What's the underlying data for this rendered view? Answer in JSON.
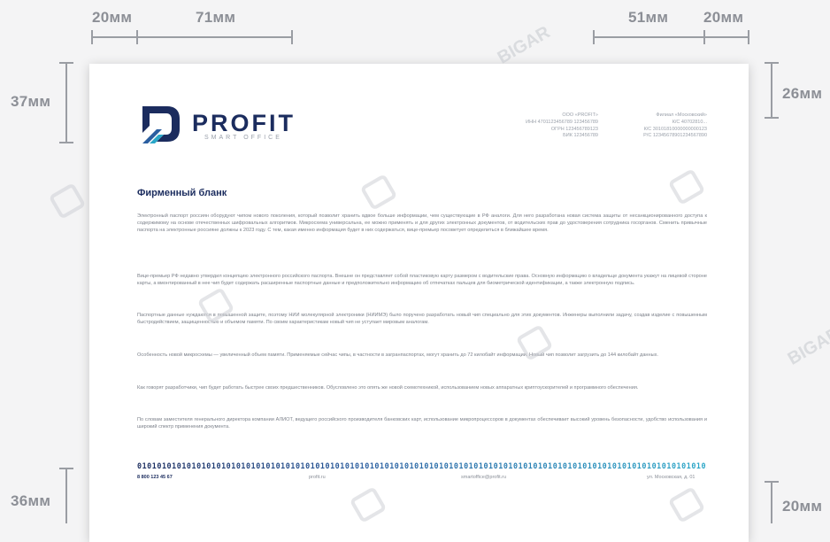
{
  "dimensions": {
    "top_left": "20мм",
    "top_logo": "71мм",
    "top_req": "51мм",
    "top_right": "20мм",
    "left_top": "37мм",
    "right_top": "26мм",
    "left_bottom": "36мм",
    "right_bottom": "20мм"
  },
  "watermark": "BIGAR",
  "letterhead": {
    "brand": "PROFIT",
    "brand_sub": "SMART OFFICE",
    "requisites_left": [
      "ООО «PROFIT»",
      "ИНН 4701123456789 123456789",
      "ОГРН 123456789123",
      "БИК 123456789"
    ],
    "requisites_right": [
      "Филиал «Московский»",
      "К/С 40702810...",
      "К/С 30101810000000000123",
      "Р/С 12345678901234567890"
    ],
    "title": "Фирменный бланк",
    "paragraphs": [
      "Электронный паспорт россиян оборудуют чипом нового поколения, который позволит хранить вдвое больше информации, чем существующие в РФ аналоги. Для него разработана новая система защиты от несанкционированного доступа к содержимому на основе отечественных шифровальных алгоритмов. Микросхема универсальна, ее можно применять и для других электронных документов, от водительских прав до удостоверения сотрудника госорганов. Сменить привычные паспорта на электронные россияне должны к 2023 году. С тем, какая именно информация будет в них содержаться, вице-премьер посоветует определиться в ближайшее время.",
      "Вице-премьер РФ недавно утвердил концепцию электронного российского паспорта. Внешне он представляет собой пластиковую карту размером с водительские права. Основную информацию о владельце документа укажут на лицевой стороне карты, а вмонтированный в нее чип будет содержать расширенные паспортные данные и предположительно информацию об отпечатках пальцев для биометрической идентификации, а также электронную подпись.",
      "Паспортные данные нуждаются в повышенной защите, поэтому НИИ молекулярной электроники (НИИМЭ) было поручено разработать новый чип специально для этих документов. Инженеры выполнили задачу, создав изделие с повышенным быстродействием, защищенностью и объемом памяти. По своим характеристикам новый чип не уступает мировым аналогам.",
      "Особенность новой микросхемы — увеличенный объем памяти. Применяемые сейчас чипы, в частности в загранпаспортах, могут хранить до 72 килобайт информации. Новый чип позволит загрузить до 144 килобайт данных.",
      "Как говорят разработчики, чип будет работать быстрее своих предшественников. Обусловлено это опять же новой схемотехникой, использованием новых аппаратных криптоускорителей и программного обеспечения.",
      "По словам заместителя генерального директора компании АЛИОТ, ведущего российского производителя банковских карт, использование микропроцессоров в документах обеспечивает высокий уровень безопасности, удобство использования и широкий спектр применения документа."
    ],
    "binary_strip": "010101010101010101010101010101010101010101010101010101010101010101010101010101010101010101010101010101010101010101010101010101",
    "footer": {
      "phone": "8 800 123 45 67",
      "site": "profit.ru",
      "email": "smartoffice@profit.ru",
      "address": "ул. Московская, д. 01"
    }
  },
  "colors": {
    "brand": "#1b2c5e",
    "accent": "#2aa7c8"
  }
}
